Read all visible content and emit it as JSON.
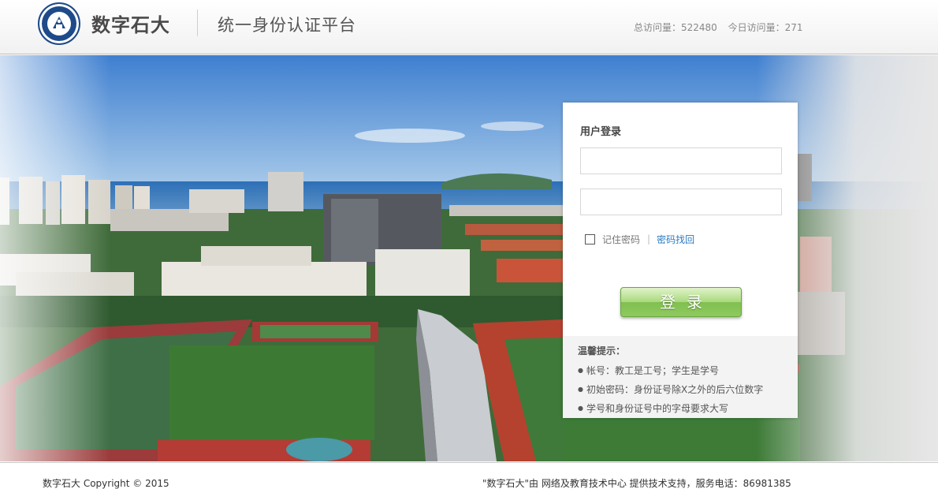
{
  "header": {
    "brand_name": "数字石大",
    "platform_title": "统一身份认证平台",
    "total_visits_label": "总访问量：522480",
    "today_visits_label": "今日访问量：271"
  },
  "login": {
    "title": "用户登录",
    "username_value": "",
    "password_value": "",
    "remember_label": "记住密码",
    "separator": "|",
    "forgot_link": "密码找回",
    "submit_label": "登录"
  },
  "tips": {
    "title": "温馨提示：",
    "items": [
      "帐号：教工是工号；学生是学号",
      "初始密码：身份证号除X之外的后六位数字",
      "学号和身份证号中的字母要求大写"
    ]
  },
  "footer": {
    "copyright": "数字石大 Copyright © 2015",
    "support": "\"数字石大\"由 网络及教育技术中心 提供技术支持，服务电话：86981385"
  },
  "colors": {
    "accent_link": "#2a7bc0",
    "button_green": "#8fca5f",
    "logo_blue": "#1f4a8a"
  },
  "icons": {
    "logo": "university-emblem-icon",
    "checkbox": "checkbox-unchecked-icon"
  }
}
